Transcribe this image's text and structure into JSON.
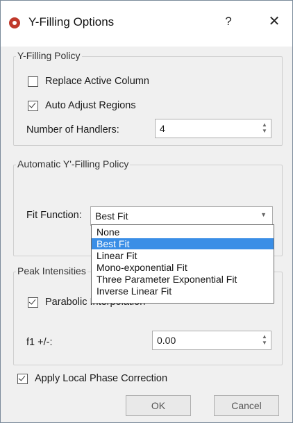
{
  "dialog": {
    "title": "Y-Filling Options",
    "help_label": "?",
    "close_label": "✕"
  },
  "y_filling_policy": {
    "title": "Y-Filling Policy",
    "replace_active_column": {
      "label": "Replace Active Column",
      "checked": false
    },
    "auto_adjust_regions": {
      "label": "Auto Adjust Regions",
      "checked": true
    },
    "number_of_handlers": {
      "label": "Number of Handlers:",
      "value": "4"
    }
  },
  "automatic_policy": {
    "title": "Automatic Y'-Filling Policy",
    "fit_function": {
      "label": "Fit Function:",
      "value": "Best Fit"
    }
  },
  "fit_function_options": [
    {
      "label": "None",
      "selected": false
    },
    {
      "label": "Best Fit",
      "selected": true
    },
    {
      "label": "Linear Fit",
      "selected": false
    },
    {
      "label": "Mono-exponential Fit",
      "selected": false
    },
    {
      "label": "Three Parameter Exponential Fit",
      "selected": false
    },
    {
      "label": "Inverse Linear Fit",
      "selected": false
    }
  ],
  "peak_intensities": {
    "title": "Peak Intensities",
    "parabolic_interpolation": {
      "label": "Parabolic Interpolation",
      "checked": true
    },
    "f1": {
      "label": "f1 +/-:",
      "value": "0.00"
    }
  },
  "apply_local_phase_correction": {
    "label": "Apply Local Phase Correction",
    "checked": true
  },
  "buttons": {
    "ok": "OK",
    "cancel": "Cancel"
  },
  "colors": {
    "accent": "#3a8ee6",
    "app_icon": "#c0392b"
  },
  "icons": {
    "app": "app-logo-icon",
    "help": "help-icon",
    "close": "close-icon",
    "dropdown": "chevron-down-icon",
    "spin": "spin-arrows-icon"
  }
}
